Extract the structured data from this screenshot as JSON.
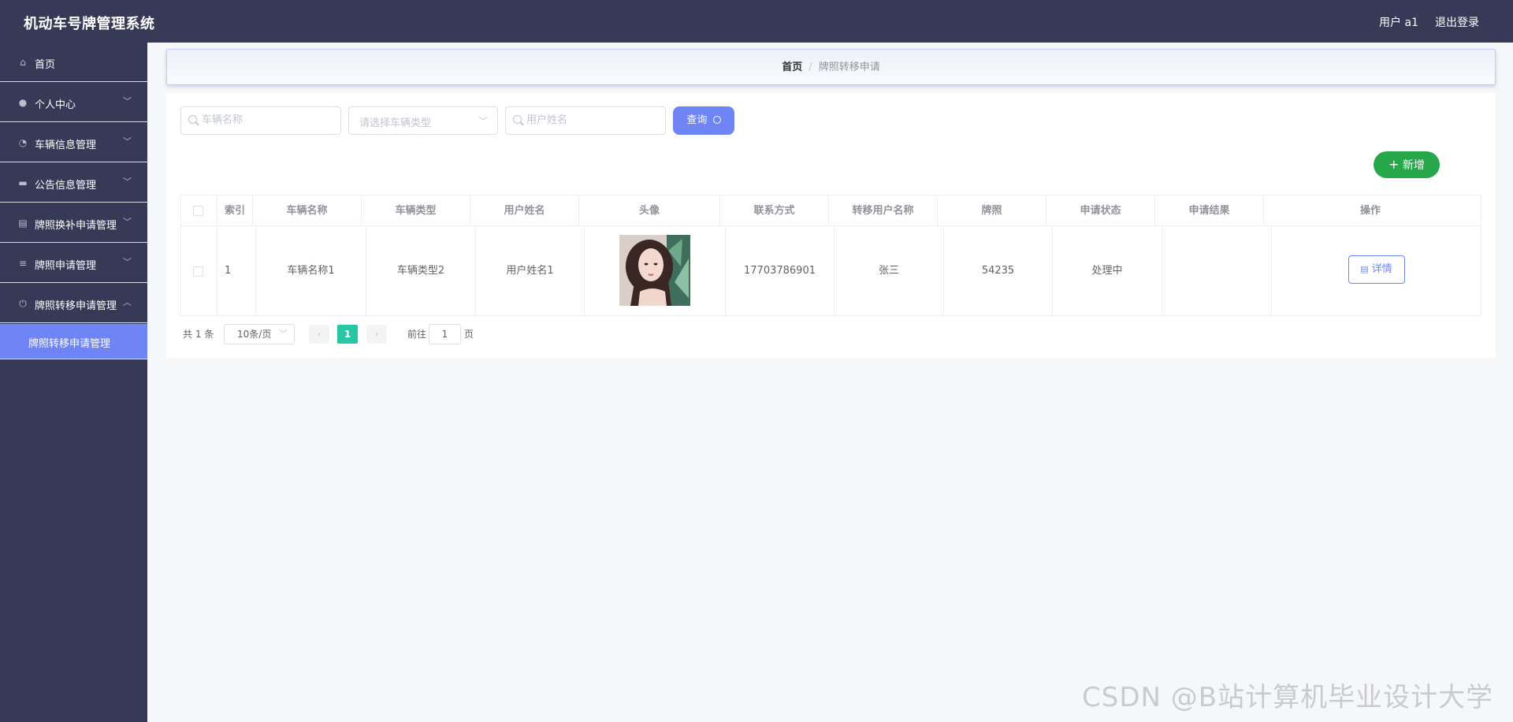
{
  "app": {
    "title": "机动车号牌管理系统",
    "user_label": "用户 a1",
    "logout_label": "退出登录"
  },
  "sidebar": {
    "items": [
      {
        "label": "首页",
        "icon": "home-icon"
      },
      {
        "label": "个人中心",
        "icon": "user-icon"
      },
      {
        "label": "车辆信息管理",
        "icon": "gauge-icon"
      },
      {
        "label": "公告信息管理",
        "icon": "monitor-icon"
      },
      {
        "label": "牌照换补申请管理",
        "icon": "briefcase-icon"
      },
      {
        "label": "牌照申请管理",
        "icon": "sliders-icon"
      },
      {
        "label": "牌照转移申请管理",
        "icon": "power-icon"
      }
    ],
    "sub_item": "牌照转移申请管理"
  },
  "breadcrumb": {
    "home": "首页",
    "separator": "/",
    "current": "牌照转移申请"
  },
  "search": {
    "vehicle_name_placeholder": "车辆名称",
    "vehicle_type_placeholder": "请选择车辆类型",
    "user_name_placeholder": "用户姓名",
    "query_label": "查询",
    "add_label": "新增"
  },
  "table": {
    "headers": [
      "索引",
      "车辆名称",
      "车辆类型",
      "用户姓名",
      "头像",
      "联系方式",
      "转移用户名称",
      "牌照",
      "申请状态",
      "申请结果",
      "操作"
    ],
    "rows": [
      {
        "index": "1",
        "vehicle_name": "车辆名称1",
        "vehicle_type": "车辆类型2",
        "user_name": "用户姓名1",
        "contact": "17703786901",
        "transfer_user": "张三",
        "plate": "54235",
        "status": "处理中",
        "result": "",
        "action_label": "详情"
      }
    ]
  },
  "pagination": {
    "total_label": "共 1 条",
    "page_size": "10条/页",
    "current_page": "1",
    "goto_prefix": "前往",
    "goto_value": "1",
    "goto_suffix": "页"
  },
  "watermark": "CSDN @B站计算机毕业设计大学",
  "colors": {
    "sidebar_bg": "#363a57",
    "accent": "#6f85f5",
    "add_button": "#26a74a",
    "page_active": "#27c6a5"
  }
}
